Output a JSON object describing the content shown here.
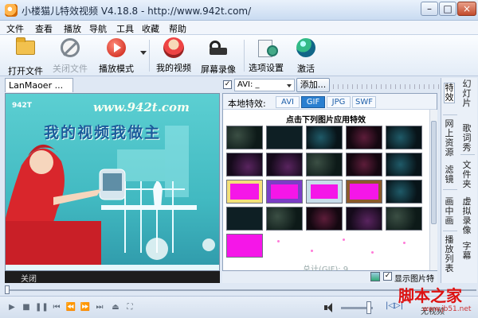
{
  "window": {
    "title": "小楼猫儿特效视频 V4.18.8 - http://www.942t.com/",
    "min": "–",
    "max": "□",
    "close": "×"
  },
  "menu": [
    "文件",
    "查看",
    "播放",
    "导航",
    "工具",
    "收藏",
    "帮助"
  ],
  "toolbar": {
    "open_file": "打开文件",
    "close_file": "关闭文件",
    "play_mode": "播放模式",
    "my_video": "我的视频",
    "screen_record": "屏幕录像",
    "options": "选项设置",
    "activate": "激活"
  },
  "left": {
    "tab": "LanMaoer ...",
    "status": "关闭"
  },
  "video": {
    "site": "www.942t.com",
    "slogan": "我的视频我做主",
    "logo": "942T"
  },
  "right": {
    "combo_value": "AVI: _",
    "add_button": "添加...",
    "local_effects_label": "本地特效:",
    "format_tabs": [
      "AVI",
      "GIF",
      "JPG",
      "SWF"
    ],
    "active_format": "GIF",
    "effects_title": "点击下列图片应用特效",
    "count_text": "总计(GIF): 9",
    "show_image_effects": "显示图片特"
  },
  "side_tabs": [
    "特效",
    "幻灯片",
    "网上资源",
    "歌词秀",
    "滤镜",
    "文件夹",
    "画中画",
    "虚拟录像",
    "播放列表",
    "字幕"
  ],
  "player": {
    "status_word": "无视频",
    "format_badge": "|◁▷|"
  },
  "watermark": {
    "text": "脚本之家",
    "url": "www.jb51.net"
  },
  "icons": {
    "open": "folder-icon",
    "close": "stop-icon",
    "play": "play-icon"
  }
}
